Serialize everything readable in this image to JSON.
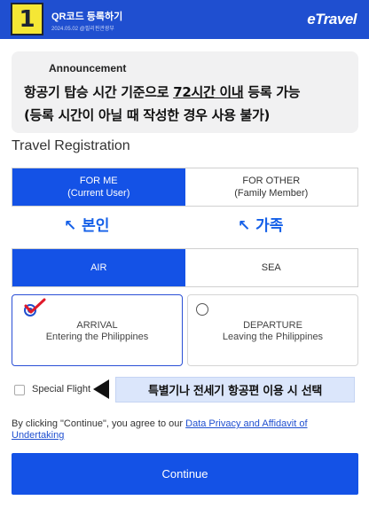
{
  "header": {
    "step_number": "1",
    "title": "QR코드 등록하기",
    "subtitle": "2024.05.02 @필리핀관광부",
    "brand": "eTravel",
    "colors": {
      "bar": "#1f4fd0",
      "badge": "#f5e735"
    }
  },
  "announcement": {
    "label": "Announcement",
    "line1_prefix": "항공기 탑승 시간 기준으로 ",
    "line1_emphasis": "72시간 이내",
    "line1_suffix": " 등록 가능",
    "line2": "(등록 시간이 아닐 때 작성한 경우 사용 불가)"
  },
  "registration": {
    "title": "Travel Registration",
    "traveler_options": [
      {
        "line1": "FOR ME",
        "line2": "(Current User)",
        "selected": true
      },
      {
        "line1": "FOR OTHER",
        "line2": "(Family Member)",
        "selected": false
      }
    ],
    "hints": {
      "self": "↖ 본인",
      "family": "↖ 가족"
    },
    "mode_options": [
      {
        "label": "AIR",
        "selected": true
      },
      {
        "label": "SEA",
        "selected": false
      }
    ],
    "direction_options": [
      {
        "line1": "ARRIVAL",
        "line2": "Entering the Philippines",
        "selected": true,
        "icon": "check-icon"
      },
      {
        "line1": "DEPARTURE",
        "line2": "Leaving the Philippines",
        "selected": false,
        "icon": "radio-icon"
      }
    ],
    "special_flight": {
      "label": "Special Flight",
      "checked": false,
      "callout": "특별기나 전세기 항공편 이용 시 선택"
    },
    "consent": {
      "prefix": "By clicking \"Continue\", you agree to our ",
      "link": "Data Privacy and Affidavit of Undertaking"
    },
    "continue_label": "Continue",
    "accent_color": "#1452e6"
  }
}
